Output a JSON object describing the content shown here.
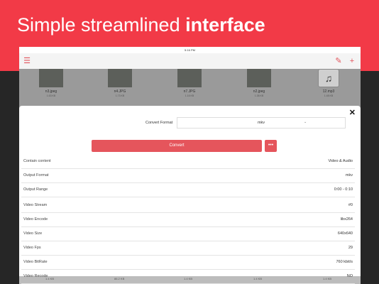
{
  "headline": {
    "regular": "Simple streamlined",
    "bold": "interface"
  },
  "status_time": "5:16 PM",
  "files": [
    {
      "name": "n3.jpeg",
      "size": "1.63 KB"
    },
    {
      "name": "n4.JPG",
      "size": "1.73 KB"
    },
    {
      "name": "n7.JPG",
      "size": "1.16 KB"
    },
    {
      "name": "n2.jpeg",
      "size": "1.38 KB"
    },
    {
      "name": "12.mp3",
      "size": "1.48 KB"
    }
  ],
  "bottom_strip": [
    "1.4 KB",
    "86.2 KB",
    "1.4 KB",
    "1.4 KB",
    "1.4 KB"
  ],
  "sheet": {
    "close_label": "✕",
    "convert_format_label": "Convert Format",
    "convert_format_value": "mkv",
    "convert_button": "Convert",
    "more_button": "•••",
    "rows": [
      {
        "k": "Contain content",
        "v": "Video & Audio"
      },
      {
        "k": "Output Format",
        "v": "mkv"
      },
      {
        "k": "Output Range",
        "v": "0:00 - 0:10"
      },
      {
        "k": "Video Stream",
        "v": "#0"
      },
      {
        "k": "Video Encode",
        "v": "libx264"
      },
      {
        "k": "Video Size",
        "v": "640x640"
      },
      {
        "k": "Video Fps",
        "v": "29"
      },
      {
        "k": "Video BitRate",
        "v": "760 kbit/s"
      },
      {
        "k": "Video Recode",
        "v": "NO"
      }
    ]
  }
}
